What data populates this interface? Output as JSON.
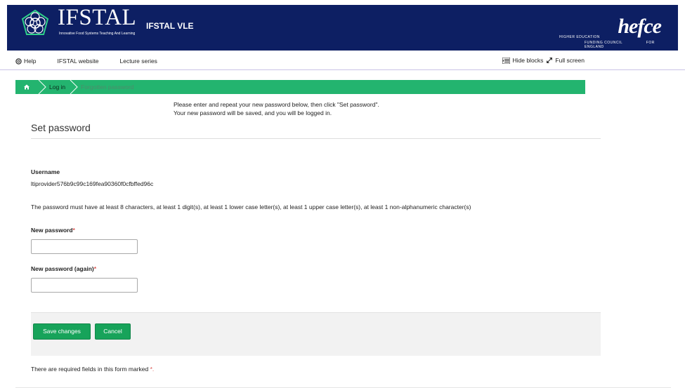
{
  "header": {
    "logo_text": "IFSTAL",
    "logo_subtitle": "Innovative Food Systems Teaching And Learning",
    "vle_title": "IFSTAL VLE",
    "partner_logo": {
      "word": "hefce",
      "line1": "HIGHER EDUCATION",
      "line2": "FUNDING COUNCIL",
      "line3": "FOR ENGLAND"
    },
    "colors": {
      "banner": "#0d1f63"
    }
  },
  "topnav": {
    "help_label": "Help",
    "website_label": "IFSTAL website",
    "lectures_label": "Lecture series",
    "hide_blocks_label": "Hide blocks",
    "full_screen_label": "Full screen"
  },
  "breadcrumb": {
    "home_icon": "home-icon",
    "items": [
      "Log in",
      "Forgotten password"
    ],
    "colors": {
      "bar": "#23b46f"
    }
  },
  "intro": {
    "line1": "Please enter and repeat your new password below, then click \"Set password\".",
    "line2": "Your new password will be saved, and you will be logged in."
  },
  "form": {
    "title": "Set password",
    "username_label": "Username",
    "username_value": "ltiprovider576b9c99c169fea90360f0cfbffed96c",
    "rule_text": "The password must have at least 8 characters, at least 1 digit(s), at least 1 lower case letter(s), at least 1 upper case letter(s), at least 1 non-alphanumeric character(s)",
    "new_password_label": "New password",
    "new_password_value": "",
    "new_password_again_label": "New password (again)",
    "new_password_again_value": "",
    "required_marker": "*",
    "save_label": "Save changes",
    "cancel_label": "Cancel",
    "required_note": "There are required fields in this form marked",
    "required_note_marker": "*.",
    "colors": {
      "button": "#17a35a",
      "required": "#d9534f"
    }
  }
}
